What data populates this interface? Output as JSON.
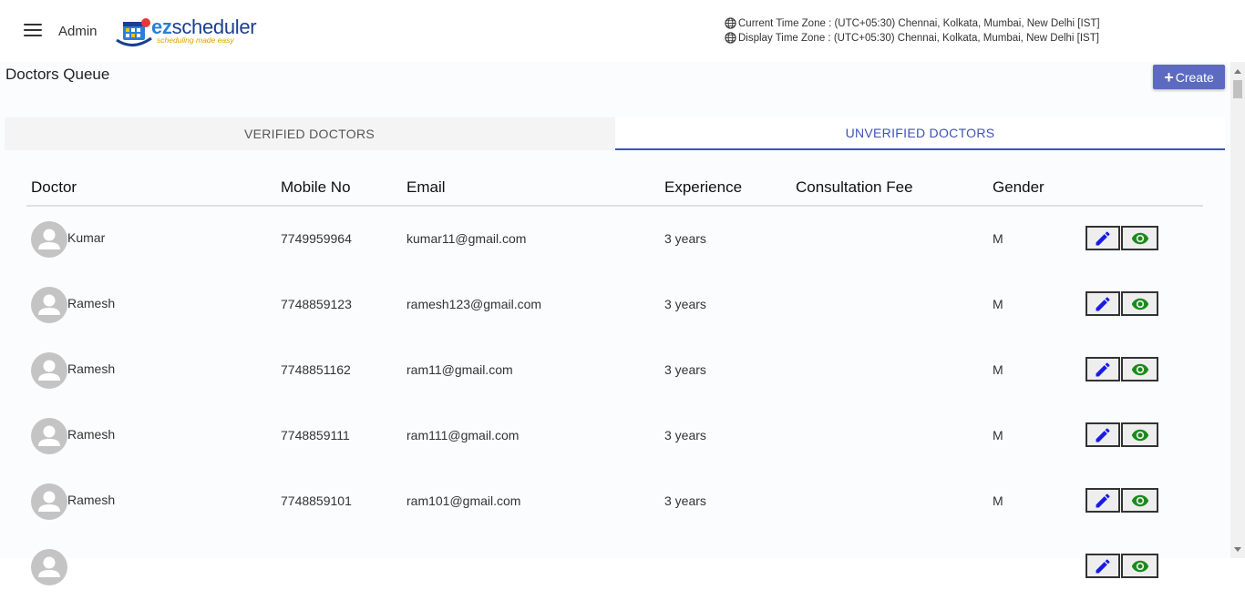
{
  "header": {
    "role_label": "Admin",
    "logo": {
      "brand_prefix": "ez",
      "brand_suffix": "scheduler",
      "tagline": "scheduling made easy"
    },
    "current_timezone": "Current Time Zone : (UTC+05:30) Chennai, Kolkata, Mumbai, New Delhi [IST]",
    "display_timezone": "Display Time Zone : (UTC+05:30) Chennai, Kolkata, Mumbai, New Delhi [IST]"
  },
  "page": {
    "title": "Doctors Queue",
    "create_label": "Create"
  },
  "tabs": [
    {
      "label": "VERIFIED DOCTORS",
      "active": false
    },
    {
      "label": "UNVERIFIED DOCTORS",
      "active": true
    }
  ],
  "table": {
    "columns": [
      "Doctor",
      "Mobile No",
      "Email",
      "Experience",
      "Consultation Fee",
      "Gender"
    ],
    "rows": [
      {
        "name": "Kumar",
        "mobile": "7749959964",
        "email": "kumar11@gmail.com",
        "experience": "3 years",
        "fee": "",
        "gender": "M"
      },
      {
        "name": "Ramesh",
        "mobile": "7748859123",
        "email": "ramesh123@gmail.com",
        "experience": "3 years",
        "fee": "",
        "gender": "M"
      },
      {
        "name": "Ramesh",
        "mobile": "7748851162",
        "email": "ram11@gmail.com",
        "experience": "3 years",
        "fee": "",
        "gender": "M"
      },
      {
        "name": "Ramesh",
        "mobile": "7748859111",
        "email": "ram111@gmail.com",
        "experience": "3 years",
        "fee": "",
        "gender": "M"
      },
      {
        "name": "Ramesh",
        "mobile": "7748859101",
        "email": "ram101@gmail.com",
        "experience": "3 years",
        "fee": "",
        "gender": "M"
      },
      {
        "name": "",
        "mobile": "",
        "email": "",
        "experience": "",
        "fee": "",
        "gender": ""
      }
    ]
  },
  "icons": {
    "menu": "hamburger-menu-icon",
    "globe": "globe-icon",
    "plus": "plus-icon",
    "edit": "pencil-edit-icon",
    "view": "eye-view-icon",
    "avatar": "person-avatar-icon"
  },
  "colors": {
    "accent": "#3f51b5",
    "create_button": "#5c6bc0",
    "edit_icon": "#1a1ae6",
    "view_icon": "#1a8a1a",
    "avatar_bg": "#c4c4c4"
  }
}
